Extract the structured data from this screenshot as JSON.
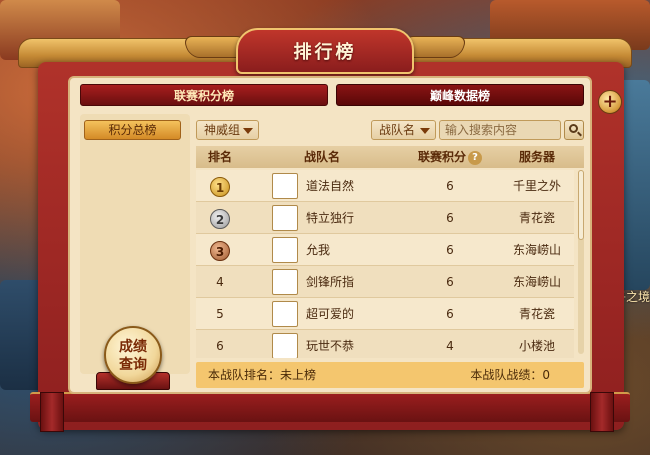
{
  "window": {
    "title": "排行榜",
    "close_icon": "close-icon",
    "close_label": "+"
  },
  "tabs": [
    {
      "label": "联赛积分榜",
      "active": false
    },
    {
      "label": "巅峰数据榜",
      "active": true
    }
  ],
  "sidebar": {
    "items": [
      {
        "label": "积分总榜",
        "selected": true
      }
    ]
  },
  "filters": {
    "group_select": "神威组",
    "team_select": "战队名",
    "search_placeholder": "输入搜索内容",
    "search_icon": "search-icon"
  },
  "table": {
    "columns": [
      "排名",
      "战队名",
      "联赛积分",
      "服务器"
    ],
    "help_label": "?",
    "rows": [
      {
        "rank": "1",
        "team": "道法自然",
        "score": "6",
        "server": "千里之外"
      },
      {
        "rank": "2",
        "team": "特立独行",
        "score": "6",
        "server": "青花瓷"
      },
      {
        "rank": "3",
        "team": "允我",
        "score": "6",
        "server": "东海崂山"
      },
      {
        "rank": "4",
        "team": "剑锋所指",
        "score": "6",
        "server": "东海崂山"
      },
      {
        "rank": "5",
        "team": "超可爱的",
        "score": "6",
        "server": "青花瓷"
      },
      {
        "rank": "6",
        "team": "玩世不恭",
        "score": "4",
        "server": "小楼池"
      }
    ]
  },
  "footer": {
    "my_rank": "本战队排名：未上榜",
    "my_record": "本战队战绩：0"
  },
  "query_button": {
    "line1": "成绩",
    "line2": "查询"
  },
  "background": {
    "side_text": "台子之境"
  },
  "colors": {
    "frame_red": "#a52a2a",
    "gold": "#f0c36a",
    "panel": "#f4e4c4",
    "footer": "#f4c66e"
  }
}
